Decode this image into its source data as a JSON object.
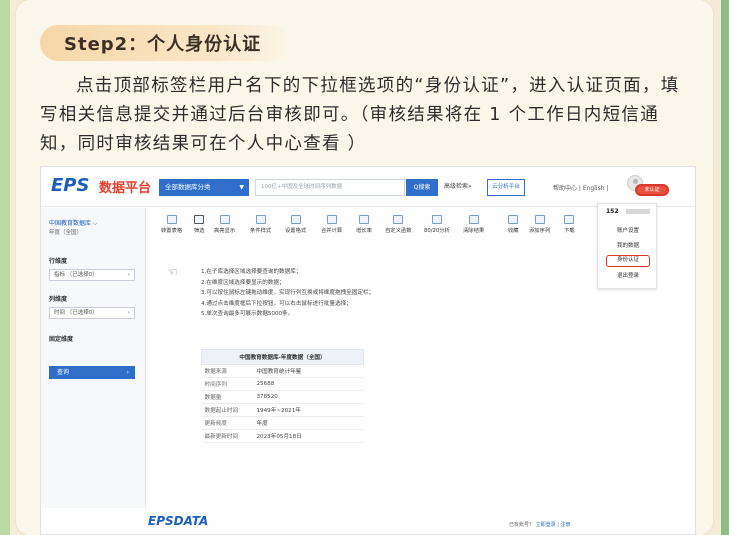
{
  "step": {
    "title": "Step2：个人身份认证"
  },
  "instruction": "点击顶部标签栏用户名下的下拉框选项的“身份认证”，进入认证页面，填写相关信息提交并通过后台审核即可。（审核结果将在 1 个工作日内短信通知，同时审核结果可在个人中心查看 ）",
  "app": {
    "logo": "EPS",
    "logo_sub": "数据平台",
    "category_btn": "全部数据库分类",
    "search_placeholder": "100亿+中国及全球时间序列数据",
    "search_btn": "Q搜索",
    "advanced": "高级检索»",
    "cloud": "云分析平台",
    "help": "帮助中心 | English |",
    "cert_badge": "未认证",
    "accent": "#2f6fc9",
    "alert_color": "#d93a2b"
  },
  "dropdown": {
    "user": "152",
    "items": [
      "账户设置",
      "我的数据",
      "身份认证",
      "退出登录"
    ]
  },
  "leftpanel": {
    "db_title": "中国教育数据库 ⌵",
    "db_sub": "年度（全国）",
    "row_dim_label": "行维度",
    "row_dim_select": "指标 （已选择0）",
    "col_dim_label": "列维度",
    "col_dim_select": "时间 （已选择0）",
    "fixed_label": "固定维度",
    "query_btn": "查询"
  },
  "toolbar": [
    "转置表格",
    "筛选",
    "高亮显示",
    "条件样式",
    "设置格式",
    "合并计算",
    "增长率",
    "自定义函数",
    "80/20分析",
    "清除结果",
    "收藏",
    "添加序列",
    "下载"
  ],
  "instructions": [
    "1.在子库选择区域选择要查询的数据库；",
    "2.在维度区域选择要显示的数据；",
    "3.可以按住鼠标左键拖动维度，实现行列互换或将维度拖拽至固定栏；",
    "4.通过点击维度框后下拉按钮，可以右击鼠标进行批量选择；",
    "5.单次查询最多可展示数据5000条。"
  ],
  "table": {
    "title": "中国教育数据库-年度数据（全国）",
    "rows": [
      {
        "k": "数据来源",
        "v": "中国教育统计年鉴"
      },
      {
        "k": "时间序列",
        "v": "25688"
      },
      {
        "k": "数据量",
        "v": "378520"
      },
      {
        "k": "数据起止时间",
        "v": "1949年~2021年"
      },
      {
        "k": "更新频度",
        "v": "年度"
      },
      {
        "k": "最新更新时间",
        "v": "2023年05月18日"
      }
    ]
  },
  "footer": {
    "logo": "EPSDATA",
    "links_prefix": "已有账号？",
    "login": "立即登录",
    "sep": "|",
    "register": "注册"
  }
}
